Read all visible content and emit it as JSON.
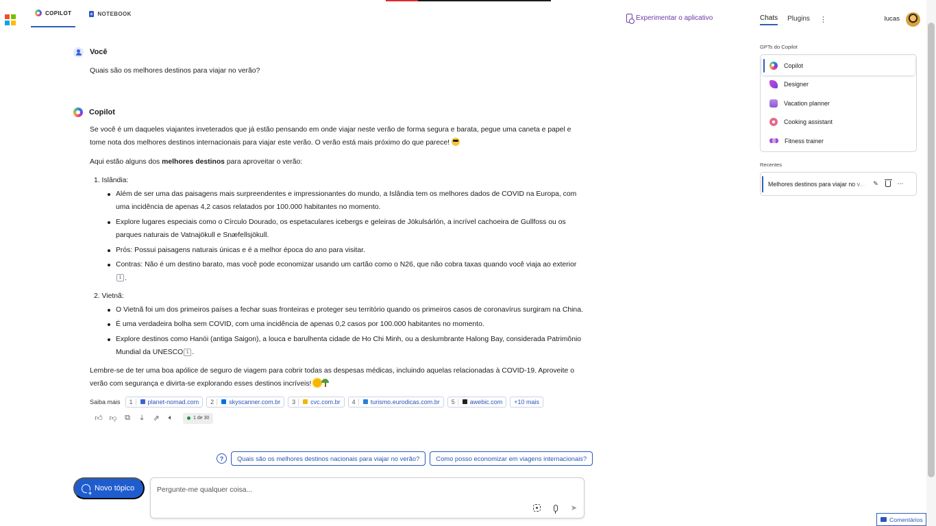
{
  "topnav": {
    "tabs": [
      {
        "label": "COPILOT",
        "active": true
      },
      {
        "label": "NOTEBOOK",
        "active": false
      }
    ],
    "try_app": "Experimentar o aplicativo"
  },
  "user_message": {
    "author": "Você",
    "text": "Quais são os melhores destinos para viajar no verão?"
  },
  "bot_message": {
    "author": "Copilot",
    "intro": "Se você é um daqueles viajantes inveterados que já estão pensando em onde viajar neste verão de forma segura e barata, pegue uma caneta e papel e tome nota dos melhores destinos internacionais para viajar este verão. O verão está mais próximo do que parece!",
    "lead_pre": "Aqui estão alguns dos ",
    "lead_bold": "melhores destinos",
    "lead_post": " para aproveitar o verão:",
    "sections": [
      {
        "title": "1. Islândia:",
        "bullets": [
          "Além de ser uma das paisagens mais surpreendentes e impressionantes do mundo, a Islândia tem os melhores dados de COVID na Europa, com uma incidência de apenas 4,2 casos relatados por 100.000 habitantes no momento.",
          "Explore lugares especiais como o Círculo Dourado, os espetaculares icebergs e geleiras de Jökulsárlón, a incrível cachoeira de Gullfoss ou os parques naturais de Vatnajökull e Snæfellsjökull.",
          "Prós: Possui paisagens naturais únicas e é a melhor época do ano para visitar.",
          "Contras: Não é um destino barato, mas você pode economizar usando um cartão como o N26, que não cobra taxas quando você viaja ao exterior"
        ]
      },
      {
        "title": "2. Vietnã:",
        "bullets": [
          "O Vietnã foi um dos primeiros países a fechar suas fronteiras e proteger seu território quando os primeiros casos de coronavírus surgiram na China.",
          "É uma verdadeira bolha sem COVID, com uma incidência de apenas 0,2 casos por 100.000 habitantes no momento.",
          "Explore destinos como Hanói (antiga Saigon), a louca e barulhenta cidade de Ho Chi Minh, ou a deslumbrante Halong Bay, considerada Patrimônio Mundial da UNESCO"
        ]
      }
    ],
    "citation": "1",
    "outro": "Lembre-se de ter uma boa apólice de seguro de viagem para cobrir todas as despesas médicas, incluindo aquelas relacionadas à COVID-19. Aproveite o verão com segurança e divirta-se explorando esses destinos incríveis!"
  },
  "sources": {
    "label": "Saiba mais",
    "items": [
      {
        "num": "1",
        "domain": "planet-nomad.com",
        "color": "#3b63d8"
      },
      {
        "num": "2",
        "domain": "skyscanner.com.br",
        "color": "#0770e3"
      },
      {
        "num": "3",
        "domain": "cvc.com.br",
        "color": "#f2b705"
      },
      {
        "num": "4",
        "domain": "turismo.eurodicas.com.br",
        "color": "#2b7fd8"
      },
      {
        "num": "5",
        "domain": "awebic.com",
        "color": "#222222"
      }
    ],
    "more": "+10 mais"
  },
  "response_meta": {
    "count": "1 de 30"
  },
  "suggestions": [
    "Quais são os melhores destinos nacionais para viajar no verão?",
    "Como posso economizar em viagens internacionais?"
  ],
  "composer": {
    "new_topic": "Novo tópico",
    "placeholder": "Pergunte-me qualquer coisa..."
  },
  "right_panel": {
    "tabs": [
      {
        "label": "Chats",
        "active": true
      },
      {
        "label": "Plugins",
        "active": false
      }
    ],
    "user_name": "lucas",
    "gpts_label": "GPTs do Copilot",
    "gpts": [
      {
        "label": "Copilot",
        "icon": "copilot-icon"
      },
      {
        "label": "Designer",
        "icon": "designer-icon"
      },
      {
        "label": "Vacation planner",
        "icon": "vacation-planner-icon"
      },
      {
        "label": "Cooking assistant",
        "icon": "cooking-assistant-icon"
      },
      {
        "label": "Fitness trainer",
        "icon": "fitness-trainer-icon"
      }
    ],
    "recent_label": "Recentes",
    "recent": [
      {
        "title": "Melhores destinos para viajar no verão"
      }
    ]
  },
  "feedback": "Comentários",
  "colors": {
    "accent": "#2b5fb5",
    "primary_button": "#1f5dcf",
    "try_app": "#6a3aa6"
  }
}
